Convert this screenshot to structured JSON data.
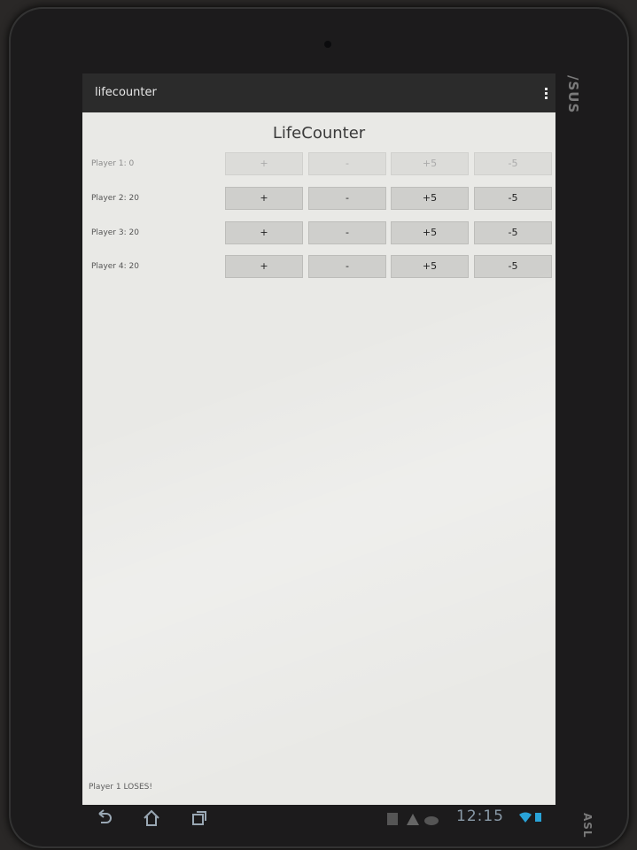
{
  "device": {
    "brand": "/SUS",
    "brand_bottom": "ASL"
  },
  "actionbar": {
    "app_title": "lifecounter",
    "overflow_icon": "overflow-menu-icon"
  },
  "main": {
    "title": "LifeCounter",
    "players": [
      {
        "label": "Player 1: 0",
        "disabled": true,
        "buttons": [
          "+",
          "-",
          "+5",
          "-5"
        ]
      },
      {
        "label": "Player 2: 20",
        "disabled": false,
        "buttons": [
          "+",
          "-",
          "+5",
          "-5"
        ]
      },
      {
        "label": "Player 3: 20",
        "disabled": false,
        "buttons": [
          "+",
          "-",
          "+5",
          "-5"
        ]
      },
      {
        "label": "Player 4: 20",
        "disabled": false,
        "buttons": [
          "+",
          "-",
          "+5",
          "-5"
        ]
      }
    ],
    "status": "Player 1 LOSES!"
  },
  "navbar": {
    "back_icon": "back-icon",
    "home_icon": "home-icon",
    "recent_icon": "recent-apps-icon",
    "clock": "12:15",
    "colors": {
      "clock": "#8a9aa8",
      "battery": "#29a3d8"
    }
  }
}
